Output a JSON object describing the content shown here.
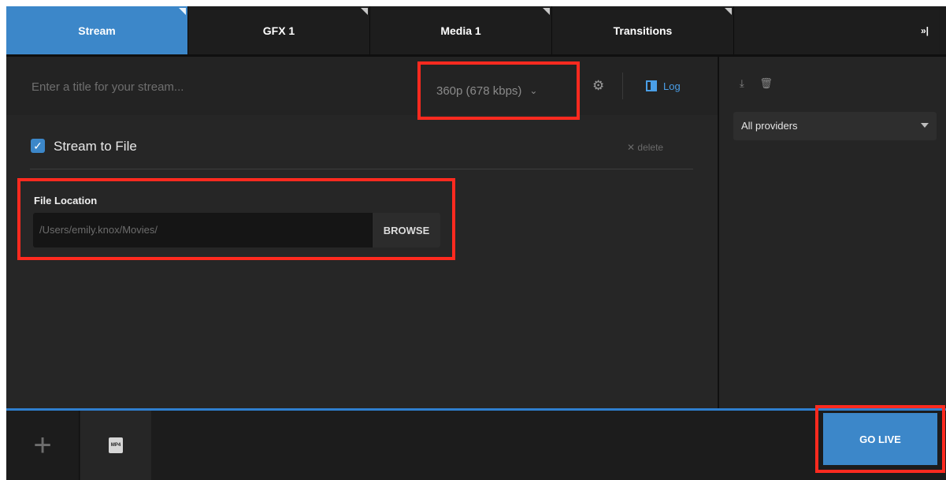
{
  "tabs": [
    {
      "label": "Stream",
      "active": true
    },
    {
      "label": "GFX 1",
      "active": false
    },
    {
      "label": "Media 1",
      "active": false
    },
    {
      "label": "Transitions",
      "active": false
    }
  ],
  "tabs_more_icon": "»|",
  "stream": {
    "title_placeholder": "Enter a title for your stream...",
    "quality": "360p (678 kbps)",
    "log_label": "Log",
    "stream_to_file_label": "Stream to File",
    "stream_to_file_checked": true,
    "delete_label": "✕ delete",
    "file_location_label": "File Location",
    "file_path": "/Users/emily.knox/Movies/",
    "browse_label": "BROWSE"
  },
  "right_panel": {
    "provider_value": "All providers"
  },
  "bottom": {
    "add_icon": "+",
    "mp4_label": "MP4",
    "go_live_label": "GO LIVE"
  },
  "colors": {
    "accent": "#3c87c9",
    "highlight": "#ff2a1f",
    "background": "#1f1f1f"
  }
}
